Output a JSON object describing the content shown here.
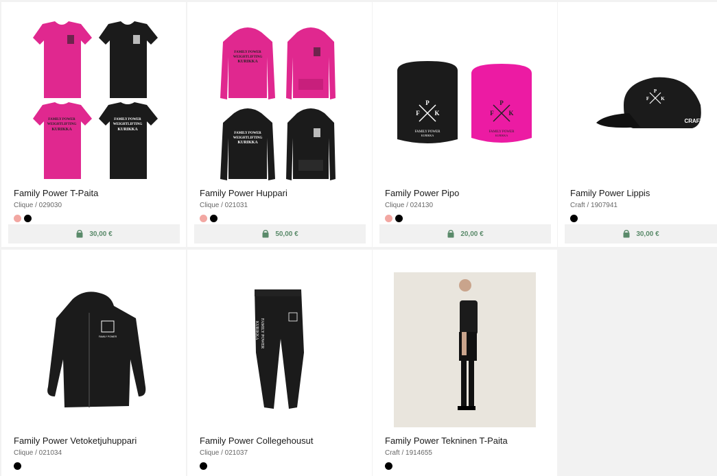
{
  "products": [
    {
      "name": "Family Power T-Paita",
      "meta": "Clique / 029030",
      "price": "30,00 €",
      "swatches": [
        "pink",
        "black"
      ]
    },
    {
      "name": "Family Power Huppari",
      "meta": "Clique / 021031",
      "price": "50,00 €",
      "swatches": [
        "pink",
        "black"
      ]
    },
    {
      "name": "Family Power Pipo",
      "meta": "Clique / 024130",
      "price": "20,00 €",
      "swatches": [
        "pink",
        "black"
      ]
    },
    {
      "name": "Family Power Lippis",
      "meta": "Craft / 1907941",
      "price": "30,00 €",
      "swatches": [
        "black"
      ]
    },
    {
      "name": "Family Power Vetoketjuhuppari",
      "meta": "Clique / 021034",
      "swatches": [
        "black"
      ]
    },
    {
      "name": "Family Power Collegehousut",
      "meta": "Clique / 021037",
      "swatches": [
        "black"
      ]
    },
    {
      "name": "Family Power Tekninen T-Paita",
      "meta": "Craft / 1914655",
      "swatches": [
        "black"
      ]
    }
  ],
  "print_text": {
    "line1": "FAMILY POWER",
    "line2": "WEIGHTLIFTING",
    "line3": "KURIKKA",
    "logo_f": "F",
    "logo_p": "P",
    "logo_k": "K",
    "beanie_line1": "FAMILY POWER",
    "beanie_line2": "KURIKKA",
    "cap_brand": "CRAFT"
  },
  "colors": {
    "pink": "#e0288f",
    "black": "#1b1b1b",
    "price": "#5a8a6a",
    "bag": "#5a8a6a"
  }
}
